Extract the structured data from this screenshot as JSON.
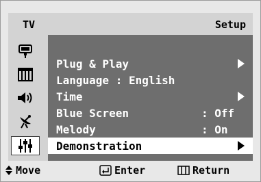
{
  "header": {
    "source_label": "TV",
    "title": "Setup"
  },
  "sidebar": {
    "icons": [
      "input-icon",
      "picture-icon",
      "sound-icon",
      "channel-icon",
      "setup-icon"
    ],
    "active_index": 4
  },
  "menu": {
    "items": [
      {
        "label": "Plug & Play",
        "value": "",
        "arrow": true
      },
      {
        "label": "Language : English",
        "value": "",
        "arrow": false
      },
      {
        "label": "Time",
        "value": "",
        "arrow": true
      },
      {
        "label": "Blue Screen",
        "value": ": Off",
        "arrow": false
      },
      {
        "label": "Melody",
        "value": ": On",
        "arrow": false
      },
      {
        "label": "Demonstration",
        "value": "",
        "arrow": true
      }
    ],
    "selected_index": 5
  },
  "footer": {
    "move_label": "Move",
    "enter_label": "Enter",
    "return_label": "Return"
  }
}
